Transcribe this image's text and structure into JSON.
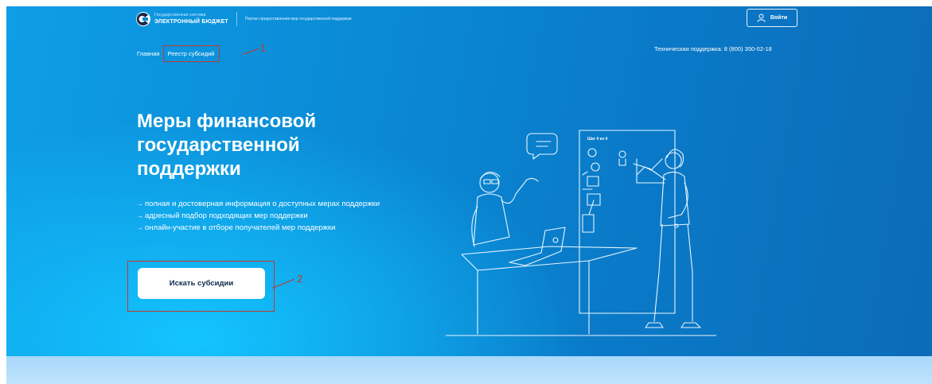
{
  "header": {
    "logo_small": "Государственная система",
    "logo_big": "ЭЛЕКТРОННЫЙ БЮДЖЕТ",
    "portal_name": "Портал предоставления мер государственной поддержки",
    "login_label": "Войти",
    "support": "Техническая поддержка: 8 (800) 350-02-18"
  },
  "breadcrumbs": {
    "home": "Главная",
    "registry": "Реестр субсидий"
  },
  "hero": {
    "title": "Меры финансовой государственной поддержки",
    "bullets": [
      "полная и достоверная информация о доступных мерах поддержки",
      "адресный подбор подходящих мер поддержки",
      "онлайн-участие в отборе получателей мер поддержки"
    ],
    "cta_label": "Искать субсидии",
    "board_text": "Шаг 4 из 4"
  },
  "annotations": {
    "one": "1",
    "two": "2"
  },
  "icons": {
    "logo": "ebudget-logo",
    "user": "user-icon",
    "arrow": "arrow-right-icon"
  },
  "colors": {
    "hero_start": "#0e9ee6",
    "hero_end": "#0b6cb8",
    "annotation": "#c0392b",
    "strip": "#bfe3fd"
  }
}
